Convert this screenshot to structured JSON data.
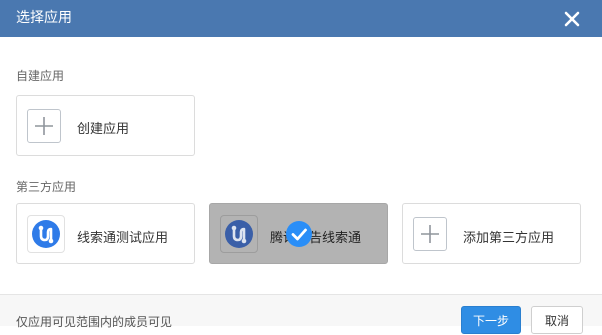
{
  "dialog": {
    "title": "选择应用"
  },
  "self_built": {
    "section_label": "自建应用",
    "create_card_label": "创建应用"
  },
  "third_party": {
    "section_label": "第三方应用",
    "apps": [
      {
        "label": "线索通测试应用",
        "selected": false
      },
      {
        "label": "腾讯广告线索通",
        "selected": true
      }
    ],
    "add_card_label": "添加第三方应用"
  },
  "footer": {
    "note": "仅应用可见范围内的成员可见",
    "next_label": "下一步",
    "cancel_label": "取消"
  },
  "colors": {
    "titlebar": "#4a78b0",
    "primary": "#2f8de4",
    "selected_overlay": "#b3b3b3",
    "check": "#2a8ef7"
  },
  "icons": {
    "close": "close-icon",
    "plus": "plus-icon",
    "app": "route-icon",
    "check": "checkmark-icon"
  }
}
